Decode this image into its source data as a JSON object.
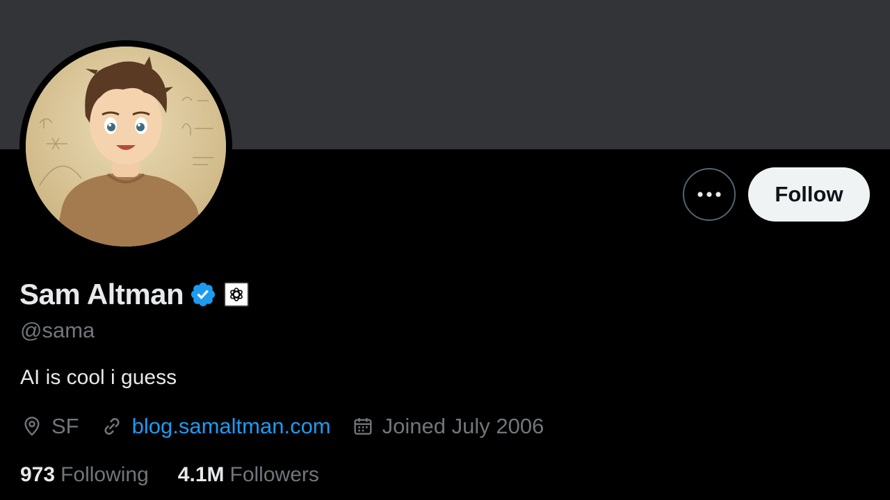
{
  "profile": {
    "display_name": "Sam Altman",
    "handle": "@sama",
    "bio": "AI is cool i guess",
    "location": "SF",
    "website": "blog.samaltman.com",
    "joined": "Joined July 2006",
    "verified_icon": "verified-badge-icon",
    "affiliation_icon": "openai-logo-icon"
  },
  "actions": {
    "more_icon": "more-horizontal-icon",
    "follow_label": "Follow"
  },
  "stats": {
    "following_count": "973",
    "following_label": "Following",
    "followers_count": "4.1M",
    "followers_label": "Followers"
  },
  "colors": {
    "banner": "#333438",
    "background": "#000000",
    "accent_link": "#1d9bf0",
    "verified": "#1d9bf0",
    "muted_text": "#71767b",
    "follow_button_bg": "#eff3f4"
  }
}
